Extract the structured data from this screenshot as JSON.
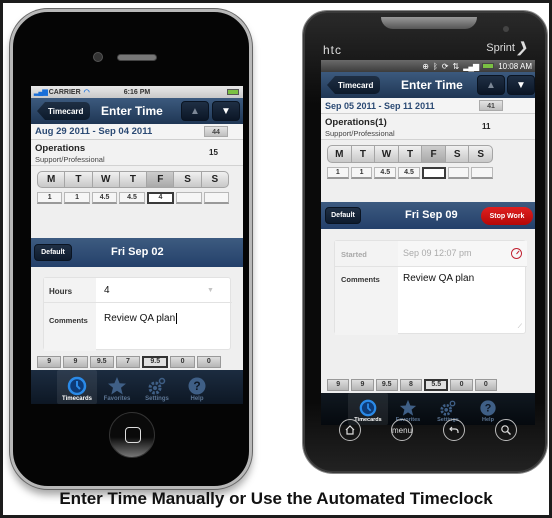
{
  "caption": "Enter Time Manually or Use the Automated Timeclock",
  "colors": {
    "navbar": "#2b4668",
    "week_range_text": "#2b4a74",
    "stop_button": "#d01010",
    "tab_active_icon": "#2a8ae8",
    "tab_inactive": "#5d7694"
  },
  "iphone": {
    "status_bar": {
      "carrier": "CARRIER",
      "time": "6:16 PM",
      "signal_icon": "signal-bars-icon",
      "wifi_icon": "wifi-icon",
      "battery_icon": "battery-icon"
    },
    "navbar": {
      "back_label": "Timecard",
      "title": "Enter Time",
      "prev_icon": "▲",
      "next_icon": "▼"
    },
    "week": {
      "range": "Aug 29 2011 - Sep 04 2011",
      "total": "44"
    },
    "project": {
      "name": "Operations",
      "subtitle": "Support/Professional",
      "hours": "15"
    },
    "days": [
      "M",
      "T",
      "W",
      "T",
      "F",
      "S",
      "S"
    ],
    "selected_day_index": 4,
    "project_hours": [
      "1",
      "1",
      "4.5",
      "4.5",
      "4",
      "",
      ""
    ],
    "day_bar": {
      "default_label": "Default",
      "title": "Fri Sep 02"
    },
    "form": {
      "hours_label": "Hours",
      "hours_value": "4",
      "comments_label": "Comments",
      "comments_value": "Review QA plan"
    },
    "daily_totals": [
      "9",
      "9",
      "9.5",
      "7",
      "9.5",
      "0",
      "0"
    ],
    "tabs": [
      {
        "label": "Timecards",
        "icon": "clock-icon",
        "active": true
      },
      {
        "label": "Favorites",
        "icon": "star-icon",
        "active": false
      },
      {
        "label": "Settings",
        "icon": "gear-icon",
        "active": false
      },
      {
        "label": "Help",
        "icon": "help-icon",
        "active": false
      }
    ]
  },
  "htc": {
    "brand": "htc",
    "carrier": "Sprint",
    "status_bar": {
      "time": "10:08 AM",
      "icons": [
        "gps-icon",
        "bluetooth-icon",
        "sync-icon",
        "data-icon",
        "signal-icon",
        "battery-icon"
      ]
    },
    "navbar": {
      "back_label": "Timecard",
      "title": "Enter Time",
      "prev_icon": "▲",
      "next_icon": "▼"
    },
    "week": {
      "range": "Sep 05 2011 - Sep 11 2011",
      "total": "41"
    },
    "project": {
      "name": "Operations(1)",
      "subtitle": "Support/Professional",
      "hours": "11"
    },
    "days": [
      "M",
      "T",
      "W",
      "T",
      "F",
      "S",
      "S"
    ],
    "selected_day_index": 4,
    "project_hours": [
      "1",
      "1",
      "4.5",
      "4.5",
      "",
      "",
      ""
    ],
    "day_bar": {
      "default_label": "Default",
      "title": "Fri Sep 09",
      "stop_label": "Stop Work"
    },
    "form": {
      "started_label": "Started",
      "started_value": "Sep 09 12:07 pm",
      "comments_label": "Comments",
      "comments_value": "Review QA plan"
    },
    "daily_totals": [
      "9",
      "9",
      "9.5",
      "8",
      "5.5",
      "0",
      "0"
    ],
    "tabs": [
      {
        "label": "Timecards",
        "icon": "clock-icon",
        "active": true
      },
      {
        "label": "Favorites",
        "icon": "star-icon",
        "active": false
      },
      {
        "label": "Settings",
        "icon": "gear-icon",
        "active": false
      },
      {
        "label": "Help",
        "icon": "help-icon",
        "active": false
      }
    ],
    "hardware_keys": [
      {
        "name": "home-key",
        "icon": "home-icon"
      },
      {
        "name": "menu-key",
        "label": "menu"
      },
      {
        "name": "back-key",
        "icon": "back-icon"
      },
      {
        "name": "search-key",
        "icon": "search-icon"
      }
    ]
  }
}
